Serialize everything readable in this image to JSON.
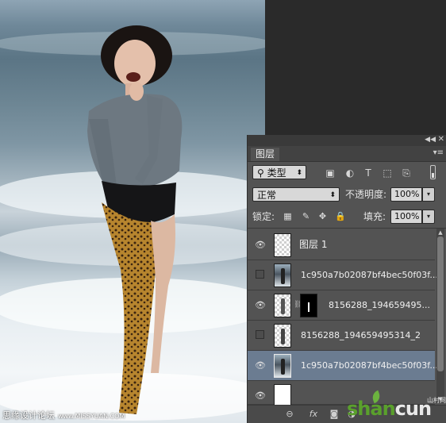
{
  "layers_panel": {
    "tab_label": "图层",
    "filter_kind": "类型",
    "blend_mode": "正常",
    "opacity_label": "不透明度:",
    "opacity_value": "100%",
    "lock_label": "锁定:",
    "fill_label": "填充:",
    "fill_value": "100%",
    "layers": [
      {
        "name": "图层 1",
        "visible": true,
        "selected": false,
        "thumb": "transparent",
        "has_mask": false
      },
      {
        "name": "1c950a7b02087bf4bec50f03f...",
        "visible": false,
        "selected": false,
        "thumb": "photo",
        "has_mask": false
      },
      {
        "name": "8156288_194659495...",
        "visible": true,
        "selected": false,
        "thumb": "transparent",
        "has_mask": true
      },
      {
        "name": "8156288_194659495314_2",
        "visible": false,
        "selected": false,
        "thumb": "transparent",
        "has_mask": false
      },
      {
        "name": "1c950a7b02087bf4bec50f03f...",
        "visible": true,
        "selected": true,
        "thumb": "photo",
        "has_mask": false
      }
    ]
  },
  "watermarks": {
    "left_text": "思缘设计论坛",
    "left_site": "www.MISSYUAN.COM",
    "right_brand_1": "shan",
    "right_brand_2": "cun",
    "right_sub": "山村网"
  },
  "colors": {
    "panel_bg": "#535353",
    "selected_layer": "#6b7c91",
    "brand_green": "#5aa02c"
  }
}
